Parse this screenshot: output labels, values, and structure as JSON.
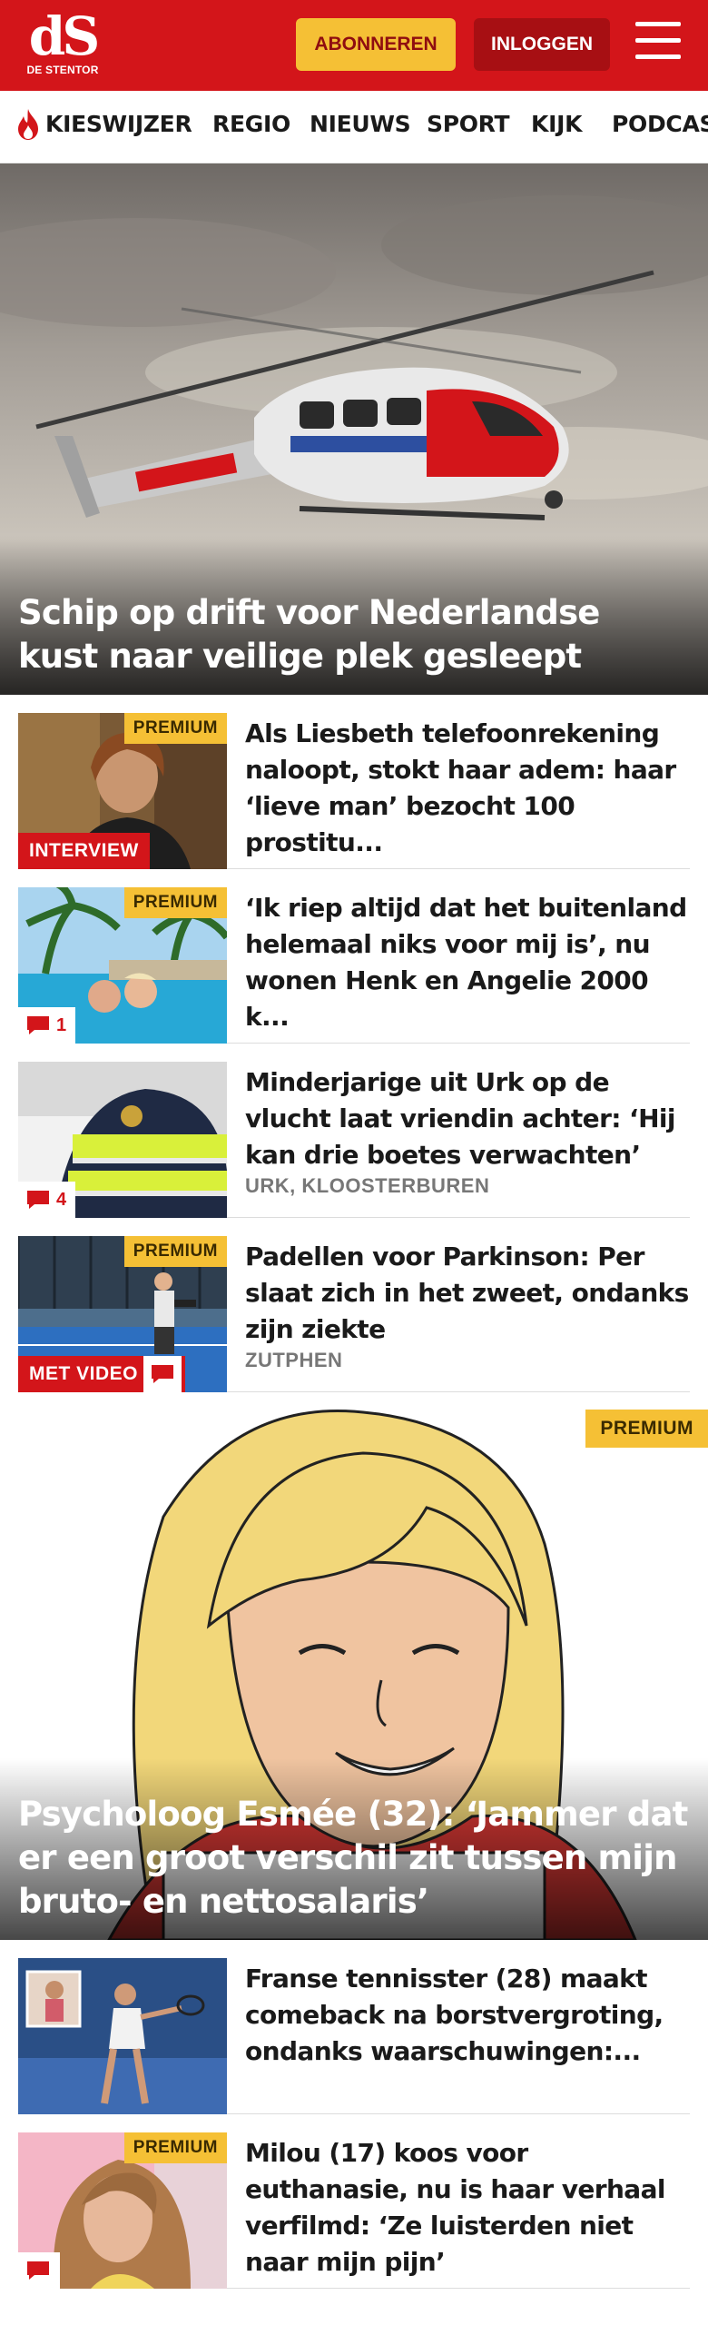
{
  "header": {
    "logo_mark": "dS",
    "logo_sub": "DE STENTOR",
    "subscribe_label": "ABONNEREN",
    "login_label": "INLOGGEN",
    "brand_color": "#d3151a",
    "accent_color": "#f5c035"
  },
  "nav": {
    "items": [
      {
        "label": "KIESWIJZER",
        "icon": "flame-icon"
      },
      {
        "label": "REGIO"
      },
      {
        "label": "NIEUWS"
      },
      {
        "label": "SPORT"
      },
      {
        "label": "KIJK"
      },
      {
        "label": "PODCAST"
      }
    ]
  },
  "hero": {
    "title": "Schip op drift voor Nederlandse kust naar veilige plek gesleept",
    "image": "rescue-helicopter-photo"
  },
  "articles": [
    {
      "title": "Als Liesbeth telefoonrekening naloopt, stokt haar adem: haar ‘lieve man’ bezocht 100 prostitu...",
      "premium": "PREMIUM",
      "label": "INTERVIEW",
      "image": "woman-portrait-photo"
    },
    {
      "title": "‘Ik riep altijd dat het buitenland helemaal niks voor mij is’, nu wonen Henk en Angelie 2000 k...",
      "premium": "PREMIUM",
      "comments": "1",
      "image": "couple-in-pool-photo"
    },
    {
      "title": "Minderjarige uit Urk op de vlucht laat vriendin achter: ‘Hij kan drie boetes verwachten’",
      "location": "URK, KLOOSTERBUREN",
      "comments": "4",
      "image": "police-officer-photo"
    },
    {
      "title": "Padellen voor Parkinson: Per slaat zich in het zweet, ondanks zijn ziekte",
      "location": "ZUTPHEN",
      "premium": "PREMIUM",
      "label": "MET VIDEO",
      "image": "padel-court-photo"
    }
  ],
  "feature": {
    "title": "Psycholoog Esmée (32): ‘Jammer dat er een groot verschil zit tussen mijn bruto- en nettosalaris’",
    "premium": "PREMIUM",
    "image": "illustrated-woman-drawing"
  },
  "articles2": [
    {
      "title": "Franse tennisster (28) maakt comeback na borstvergroting, ondanks waarschuwingen:...",
      "image": "tennis-player-photo"
    },
    {
      "title": "Milou (17) koos voor euthanasie, nu is haar verhaal verfilmd: ‘Ze luisterden niet naar mijn pijn’",
      "premium": "PREMIUM",
      "image": "girl-portrait-photo"
    }
  ]
}
